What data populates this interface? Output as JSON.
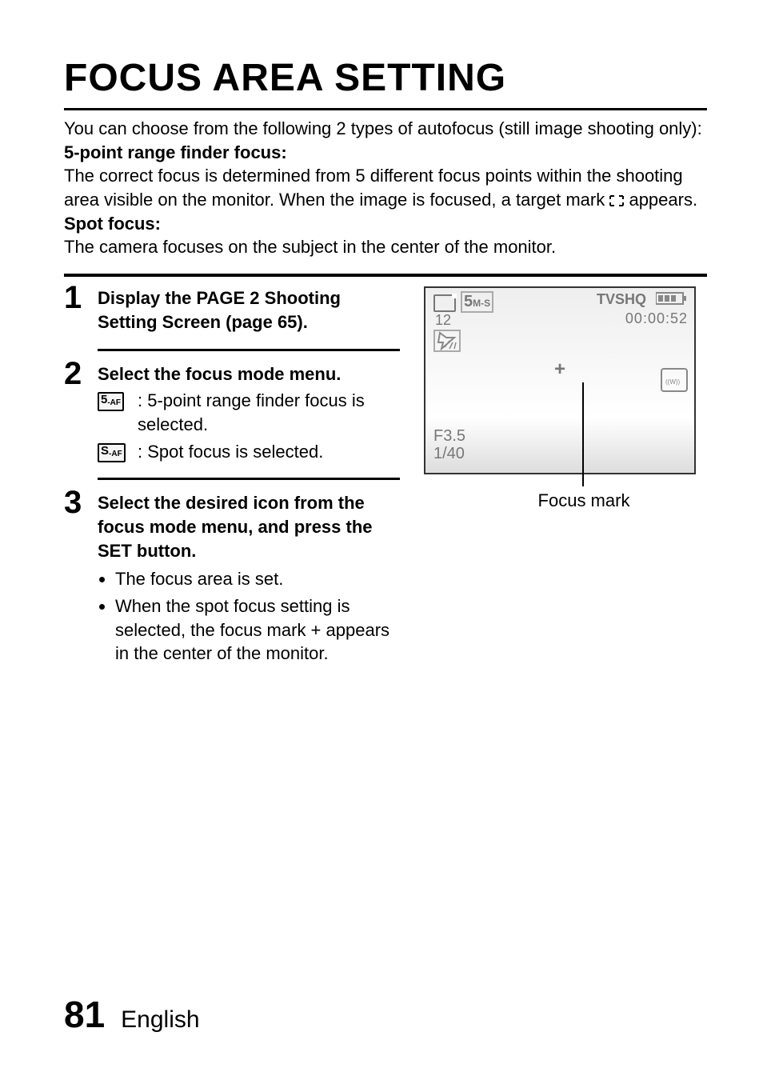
{
  "page": {
    "title": "FOCUS AREA SETTING",
    "intro_lead": "You can choose from the following 2 types of autofocus (still image shooting only):",
    "five_point": {
      "label": "5-point range finder focus:",
      "desc_before": "The correct focus is determined from 5 different focus points within the shooting area visible on the monitor. When the image is focused, a target mark ",
      "desc_after": " appears."
    },
    "spot": {
      "label": "Spot focus:",
      "desc": "The camera focuses on the subject in the center of the monitor."
    },
    "number": "81",
    "language": "English"
  },
  "steps": {
    "s1": {
      "num": "1",
      "head": "Display the PAGE 2 Shooting Setting Screen (page 65)."
    },
    "s2": {
      "num": "2",
      "head": "Select the focus mode menu.",
      "opt1_icon_main": "5",
      "opt1_icon_sub": "-AF",
      "opt1_text": ": 5-point range finder focus is selected.",
      "opt2_icon_main": "S",
      "opt2_icon_sub": "-AF",
      "opt2_text": ": Spot focus is selected."
    },
    "s3": {
      "num": "3",
      "head": "Select the desired icon from the focus mode menu, and press the SET button.",
      "b1": "The focus area is set.",
      "b2": "When the spot focus setting is selected, the focus mark + appears in the center of the monitor."
    }
  },
  "figure": {
    "label": "Focus mark",
    "lcd": {
      "size_main": "5",
      "size_sub": "M-S",
      "count": "12",
      "tv": "TVSHQ",
      "time": "00:00:52",
      "aperture": "F3.5",
      "shutter": "1/40",
      "plus": "+"
    }
  }
}
